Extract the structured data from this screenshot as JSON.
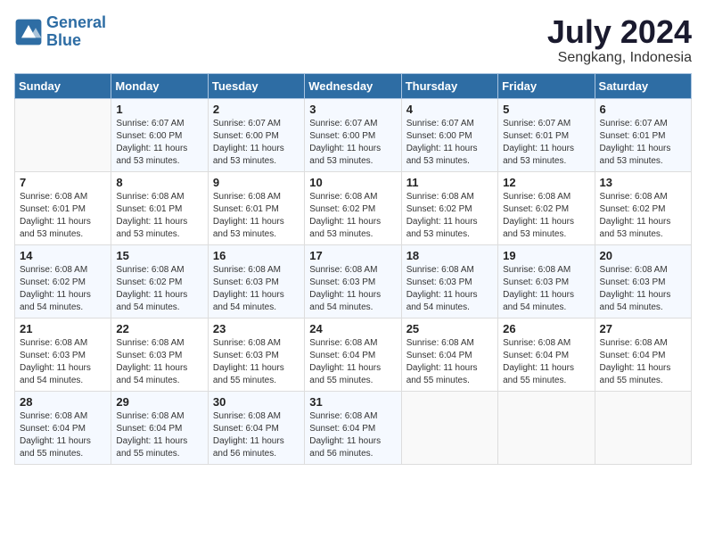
{
  "header": {
    "logo_line1": "General",
    "logo_line2": "Blue",
    "month_year": "July 2024",
    "location": "Sengkang, Indonesia"
  },
  "weekdays": [
    "Sunday",
    "Monday",
    "Tuesday",
    "Wednesday",
    "Thursday",
    "Friday",
    "Saturday"
  ],
  "weeks": [
    [
      {
        "day": "",
        "info": ""
      },
      {
        "day": "1",
        "info": "Sunrise: 6:07 AM\nSunset: 6:00 PM\nDaylight: 11 hours\nand 53 minutes."
      },
      {
        "day": "2",
        "info": "Sunrise: 6:07 AM\nSunset: 6:00 PM\nDaylight: 11 hours\nand 53 minutes."
      },
      {
        "day": "3",
        "info": "Sunrise: 6:07 AM\nSunset: 6:00 PM\nDaylight: 11 hours\nand 53 minutes."
      },
      {
        "day": "4",
        "info": "Sunrise: 6:07 AM\nSunset: 6:00 PM\nDaylight: 11 hours\nand 53 minutes."
      },
      {
        "day": "5",
        "info": "Sunrise: 6:07 AM\nSunset: 6:01 PM\nDaylight: 11 hours\nand 53 minutes."
      },
      {
        "day": "6",
        "info": "Sunrise: 6:07 AM\nSunset: 6:01 PM\nDaylight: 11 hours\nand 53 minutes."
      }
    ],
    [
      {
        "day": "7",
        "info": "Sunrise: 6:08 AM\nSunset: 6:01 PM\nDaylight: 11 hours\nand 53 minutes."
      },
      {
        "day": "8",
        "info": "Sunrise: 6:08 AM\nSunset: 6:01 PM\nDaylight: 11 hours\nand 53 minutes."
      },
      {
        "day": "9",
        "info": "Sunrise: 6:08 AM\nSunset: 6:01 PM\nDaylight: 11 hours\nand 53 minutes."
      },
      {
        "day": "10",
        "info": "Sunrise: 6:08 AM\nSunset: 6:02 PM\nDaylight: 11 hours\nand 53 minutes."
      },
      {
        "day": "11",
        "info": "Sunrise: 6:08 AM\nSunset: 6:02 PM\nDaylight: 11 hours\nand 53 minutes."
      },
      {
        "day": "12",
        "info": "Sunrise: 6:08 AM\nSunset: 6:02 PM\nDaylight: 11 hours\nand 53 minutes."
      },
      {
        "day": "13",
        "info": "Sunrise: 6:08 AM\nSunset: 6:02 PM\nDaylight: 11 hours\nand 53 minutes."
      }
    ],
    [
      {
        "day": "14",
        "info": "Sunrise: 6:08 AM\nSunset: 6:02 PM\nDaylight: 11 hours\nand 54 minutes."
      },
      {
        "day": "15",
        "info": "Sunrise: 6:08 AM\nSunset: 6:02 PM\nDaylight: 11 hours\nand 54 minutes."
      },
      {
        "day": "16",
        "info": "Sunrise: 6:08 AM\nSunset: 6:03 PM\nDaylight: 11 hours\nand 54 minutes."
      },
      {
        "day": "17",
        "info": "Sunrise: 6:08 AM\nSunset: 6:03 PM\nDaylight: 11 hours\nand 54 minutes."
      },
      {
        "day": "18",
        "info": "Sunrise: 6:08 AM\nSunset: 6:03 PM\nDaylight: 11 hours\nand 54 minutes."
      },
      {
        "day": "19",
        "info": "Sunrise: 6:08 AM\nSunset: 6:03 PM\nDaylight: 11 hours\nand 54 minutes."
      },
      {
        "day": "20",
        "info": "Sunrise: 6:08 AM\nSunset: 6:03 PM\nDaylight: 11 hours\nand 54 minutes."
      }
    ],
    [
      {
        "day": "21",
        "info": "Sunrise: 6:08 AM\nSunset: 6:03 PM\nDaylight: 11 hours\nand 54 minutes."
      },
      {
        "day": "22",
        "info": "Sunrise: 6:08 AM\nSunset: 6:03 PM\nDaylight: 11 hours\nand 54 minutes."
      },
      {
        "day": "23",
        "info": "Sunrise: 6:08 AM\nSunset: 6:03 PM\nDaylight: 11 hours\nand 55 minutes."
      },
      {
        "day": "24",
        "info": "Sunrise: 6:08 AM\nSunset: 6:04 PM\nDaylight: 11 hours\nand 55 minutes."
      },
      {
        "day": "25",
        "info": "Sunrise: 6:08 AM\nSunset: 6:04 PM\nDaylight: 11 hours\nand 55 minutes."
      },
      {
        "day": "26",
        "info": "Sunrise: 6:08 AM\nSunset: 6:04 PM\nDaylight: 11 hours\nand 55 minutes."
      },
      {
        "day": "27",
        "info": "Sunrise: 6:08 AM\nSunset: 6:04 PM\nDaylight: 11 hours\nand 55 minutes."
      }
    ],
    [
      {
        "day": "28",
        "info": "Sunrise: 6:08 AM\nSunset: 6:04 PM\nDaylight: 11 hours\nand 55 minutes."
      },
      {
        "day": "29",
        "info": "Sunrise: 6:08 AM\nSunset: 6:04 PM\nDaylight: 11 hours\nand 55 minutes."
      },
      {
        "day": "30",
        "info": "Sunrise: 6:08 AM\nSunset: 6:04 PM\nDaylight: 11 hours\nand 56 minutes."
      },
      {
        "day": "31",
        "info": "Sunrise: 6:08 AM\nSunset: 6:04 PM\nDaylight: 11 hours\nand 56 minutes."
      },
      {
        "day": "",
        "info": ""
      },
      {
        "day": "",
        "info": ""
      },
      {
        "day": "",
        "info": ""
      }
    ]
  ]
}
